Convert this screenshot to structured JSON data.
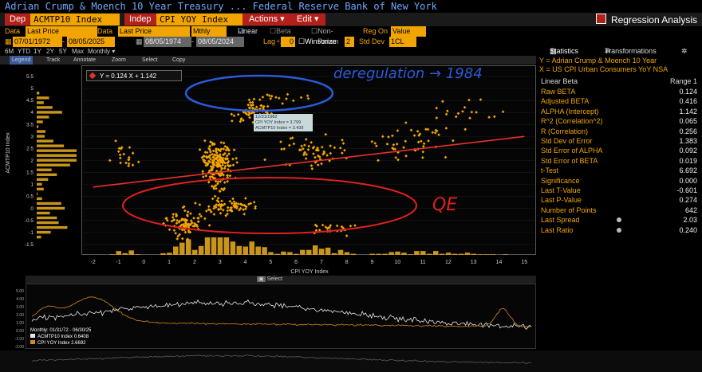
{
  "window": {
    "title": "Adrian Crump & Moench 10 Year Treasury ...  Federal Reserve Bank of New York",
    "app_title": "Regression Analysis"
  },
  "toolbar": {
    "dep_label": "Dep",
    "dep_ticker": "ACMTP10 Index",
    "indep_label": "Indep",
    "indep_ticker": "CPI YOY Index",
    "actions_label": "Actions ▾",
    "edit_label": "Edit ▾"
  },
  "settings": {
    "data1_label": "Data",
    "data1_value": "Last Price",
    "data2_label": "Data",
    "data2_value": "Last Price",
    "freq": "Mthly",
    "linear_label": "Linear",
    "beta_label": "Beta +/-",
    "nonparam_label": "Non-Param",
    "regon_label": "Reg On",
    "regon_value": "Value",
    "date_from1": "07/01/1972",
    "date_to1": "08/05/2025",
    "date_from2": "08/05/1974",
    "date_to2": "08/05/2024",
    "lag_label": "Lag",
    "lag_value": "0",
    "winsorize_label": "Winsorize",
    "winsorize_value": "2",
    "stddev_label": "Std Dev",
    "stddev_value": "1CL"
  },
  "periods": [
    "6M",
    "YTD",
    "1Y",
    "2Y",
    "5Y",
    "Max",
    "Monthly ▾"
  ],
  "chart_tools": [
    "Legend",
    "Track",
    "Annotate",
    "Zoom",
    "Select",
    "Copy"
  ],
  "stats_tabs": {
    "statistics": "Statistics",
    "transformations": "Transformations"
  },
  "stats_info": {
    "y_line": "Y = Adrian Crump & Moench 10 Year",
    "x_line": "X = US CPI Urban Consumers YoY NSA",
    "col_header": "Linear Beta",
    "range_header": "Range 1"
  },
  "stats": [
    {
      "label": "Raw BETA",
      "value": "0.124"
    },
    {
      "label": "Adjusted BETA",
      "value": "0.416"
    },
    {
      "label": "ALPHA (Intercept)",
      "value": "1.142"
    },
    {
      "label": "R^2 (Correlation^2)",
      "value": "0.065"
    },
    {
      "label": "R (Correlation)",
      "value": "0.256"
    },
    {
      "label": "Std Dev of Error",
      "value": "1.383"
    },
    {
      "label": "Std Error of ALPHA",
      "value": "0.092"
    },
    {
      "label": "Std Error of BETA",
      "value": "0.019"
    },
    {
      "label": "t-Test",
      "value": "6.692"
    },
    {
      "label": "Significance",
      "value": "0.000"
    },
    {
      "label": "Last T-Value",
      "value": "-0.601"
    },
    {
      "label": "Last P-Value",
      "value": "0.274"
    },
    {
      "label": "Number of Points",
      "value": "642"
    },
    {
      "label": "Last Spread",
      "value": "2.03"
    },
    {
      "label": "Last Ratio",
      "value": "0.240"
    }
  ],
  "scatter": {
    "legend_text": "Y = 0.124 X + 1.142",
    "y_axis_title": "ACMTP10 Index",
    "x_axis_title": "CPI YOY Index",
    "x_ticks": [
      "-2",
      "-1",
      "0",
      "1",
      "2",
      "3",
      "4",
      "5",
      "6",
      "7",
      "8",
      "9",
      "10",
      "11",
      "12",
      "13",
      "14",
      "15"
    ],
    "y_ticks": [
      "5.5",
      "5",
      "4.5",
      "4",
      "3.5",
      "3",
      "2.5",
      "2",
      "1.5",
      "1",
      "0.5",
      "0",
      "-0.5",
      "-1",
      "-1.5"
    ],
    "tooltip": [
      "12/31/1982",
      "CPI YOY Index = 3.799",
      "ACMTP10 Index = 3.439"
    ]
  },
  "annotations": {
    "top": "deregulation → 1984",
    "bottom": "QE"
  },
  "timeseries": {
    "select_label": "Select",
    "legend_title": "Monthly: 01/31/72 - 06/30/25",
    "series1_name": "ACMTP10 Index",
    "series1_value": "0.6408",
    "series2_name": "CPI YOY Index",
    "series2_value": "2.6692",
    "y_ticks": [
      "5.00",
      "4.00",
      "3.00",
      "2.00",
      "1.00",
      "0.00",
      "-1.00",
      "-2.00"
    ]
  },
  "colors": {
    "accent": "#f2a500",
    "bar": "#b3201a",
    "regression": "#e8302a",
    "annotation_blue": "#2a5bd7",
    "annotation_red": "#e02020"
  }
}
